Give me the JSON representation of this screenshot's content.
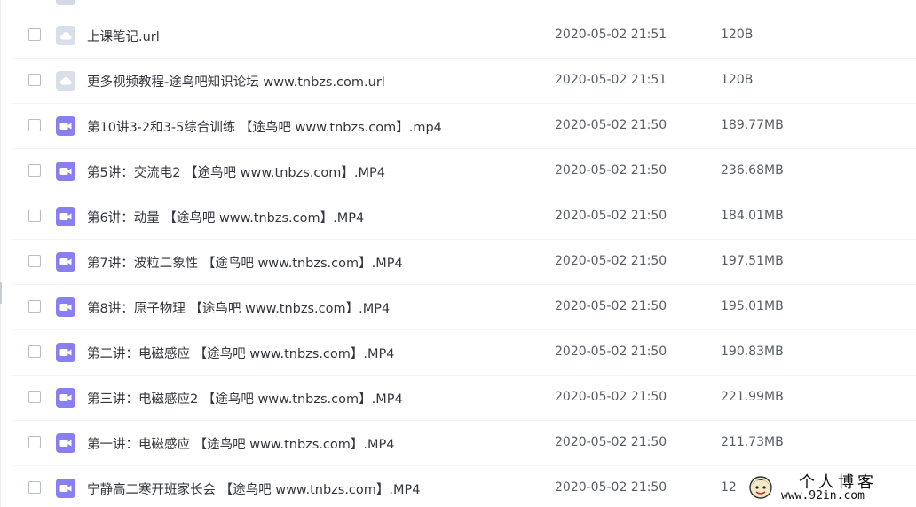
{
  "colors": {
    "video_icon": "#8a7ff0",
    "url_icon": "#d9dfe8",
    "text_primary": "#33363d",
    "text_secondary": "#575c66"
  },
  "files": [
    {
      "name": "上课笔记.url",
      "date": "2020-05-02 21:51",
      "size": "120B",
      "type": "url",
      "icon": "cloud-icon"
    },
    {
      "name": "更多视频教程-途鸟吧知识论坛 www.tnbzs.com.url",
      "date": "2020-05-02 21:51",
      "size": "120B",
      "type": "url",
      "icon": "cloud-icon"
    },
    {
      "name": "第10讲3-2和3-5综合训练 【途鸟吧 www.tnbzs.com】.mp4",
      "date": "2020-05-02 21:50",
      "size": "189.77MB",
      "type": "video",
      "icon": "video-icon"
    },
    {
      "name": "第5讲：交流电2 【途鸟吧 www.tnbzs.com】.MP4",
      "date": "2020-05-02 21:50",
      "size": "236.68MB",
      "type": "video",
      "icon": "video-icon"
    },
    {
      "name": "第6讲：动量 【途鸟吧 www.tnbzs.com】.MP4",
      "date": "2020-05-02 21:50",
      "size": "184.01MB",
      "type": "video",
      "icon": "video-icon"
    },
    {
      "name": "第7讲：波粒二象性 【途鸟吧 www.tnbzs.com】.MP4",
      "date": "2020-05-02 21:50",
      "size": "197.51MB",
      "type": "video",
      "icon": "video-icon"
    },
    {
      "name": "第8讲：原子物理 【途鸟吧 www.tnbzs.com】.MP4",
      "date": "2020-05-02 21:50",
      "size": "195.01MB",
      "type": "video",
      "icon": "video-icon"
    },
    {
      "name": "第二讲：电磁感应 【途鸟吧 www.tnbzs.com】.MP4",
      "date": "2020-05-02 21:50",
      "size": "190.83MB",
      "type": "video",
      "icon": "video-icon"
    },
    {
      "name": "第三讲：电磁感应2 【途鸟吧 www.tnbzs.com】.MP4",
      "date": "2020-05-02 21:50",
      "size": "221.99MB",
      "type": "video",
      "icon": "video-icon"
    },
    {
      "name": "第一讲：电磁感应 【途鸟吧 www.tnbzs.com】.MP4",
      "date": "2020-05-02 21:50",
      "size": "211.73MB",
      "type": "video",
      "icon": "video-icon"
    },
    {
      "name": "宁静高二寒开班家长会 【途鸟吧 www.tnbzs.com】.MP4",
      "date": "2020-05-02 21:50",
      "size": "12",
      "type": "video",
      "icon": "video-icon"
    }
  ],
  "watermark": {
    "title": "个人博客",
    "url": "www.92in.com"
  }
}
